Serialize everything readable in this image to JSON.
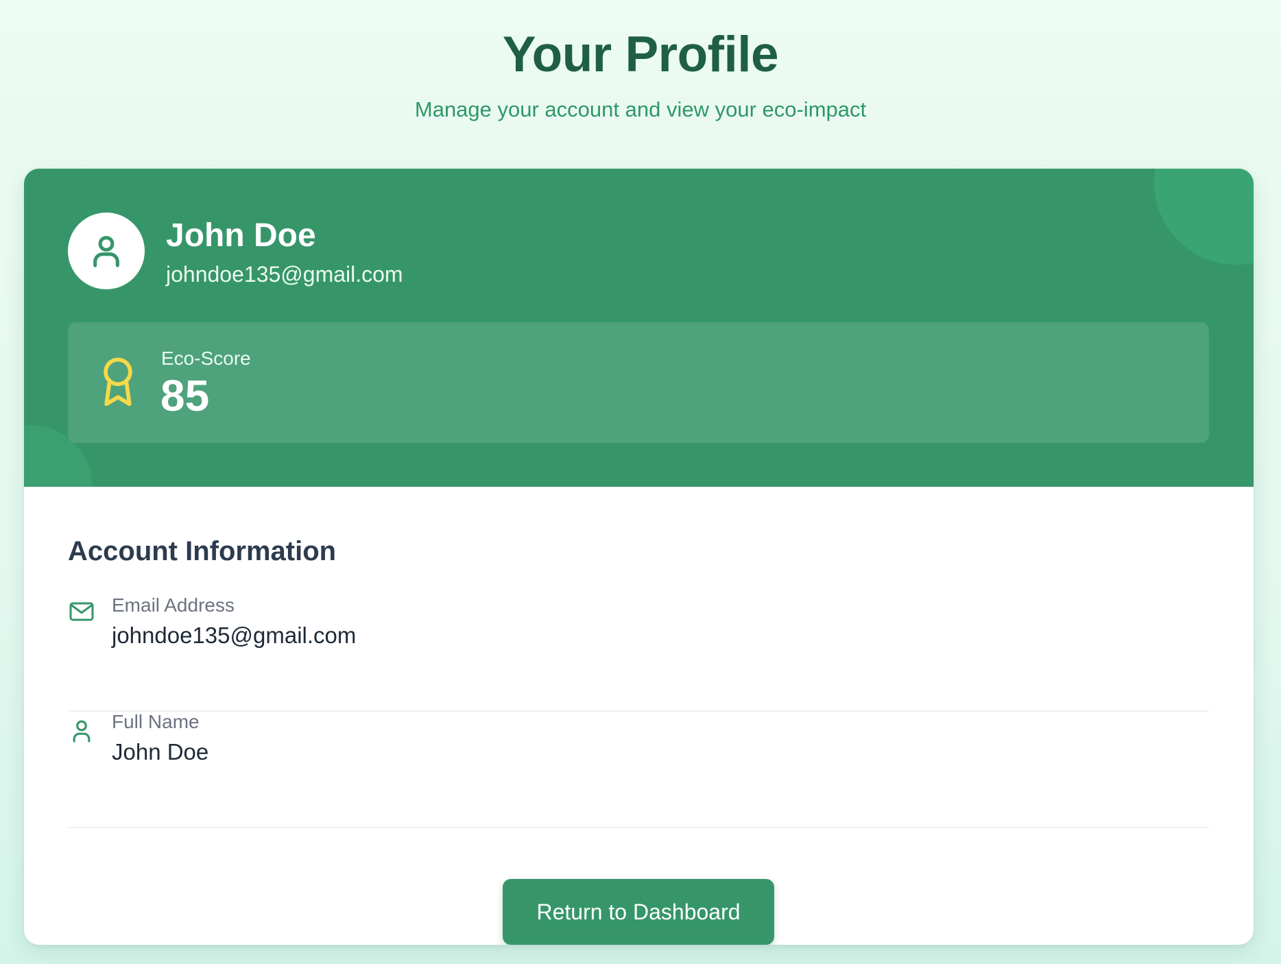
{
  "header": {
    "title": "Your Profile",
    "subtitle": "Manage your account and view your eco-impact"
  },
  "profile": {
    "avatar_icon": "user-icon",
    "name": "John Doe",
    "email": "johndoe135@gmail.com"
  },
  "eco_score": {
    "icon": "award-ribbon-icon",
    "label": "Eco-Score",
    "value": "85"
  },
  "account_info": {
    "title": "Account Information",
    "fields": [
      {
        "icon": "mail-icon",
        "label": "Email Address",
        "value": "johndoe135@gmail.com"
      },
      {
        "icon": "user-icon",
        "label": "Full Name",
        "value": "John Doe"
      }
    ]
  },
  "actions": {
    "return_label": "Return to Dashboard"
  },
  "colors": {
    "primary": "#36966a",
    "title": "#1f5f43",
    "subtitle": "#2f9767",
    "award": "#f5d94a"
  }
}
